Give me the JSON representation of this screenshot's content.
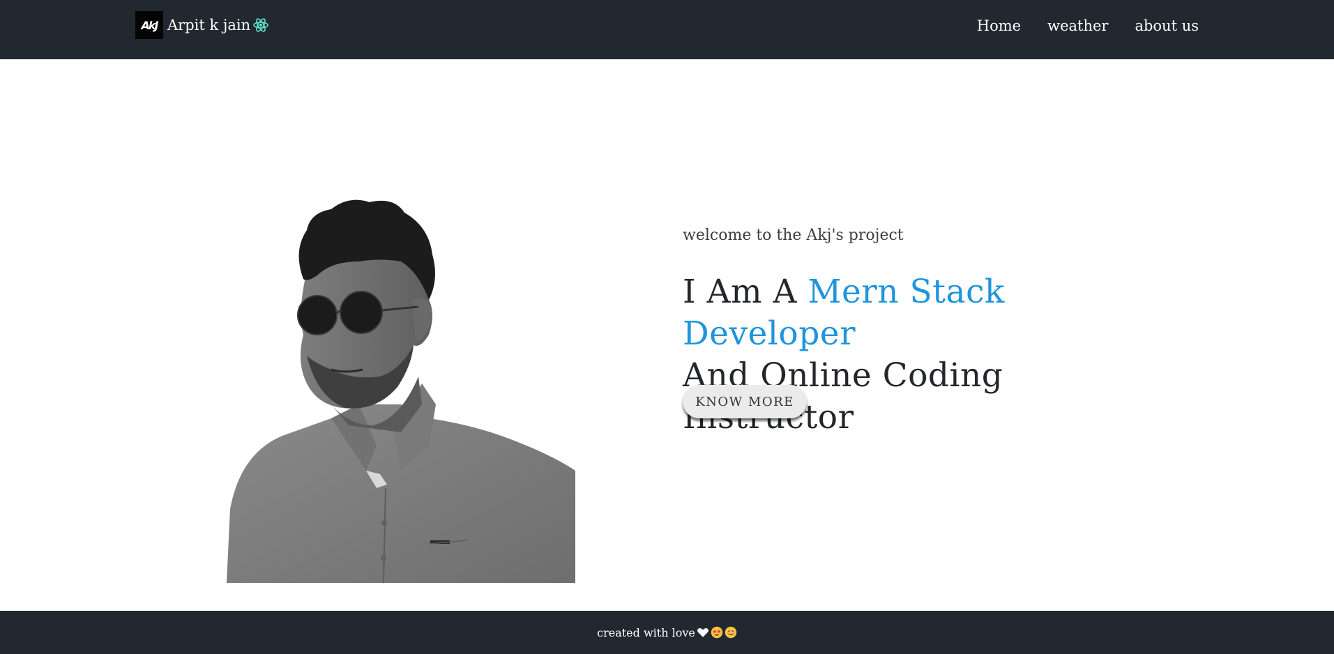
{
  "navbar": {
    "brand_logo_text": "AkJ",
    "brand_name": "Arpit k jain",
    "brand_icon": "react-atom-icon",
    "links": [
      {
        "label": "Home"
      },
      {
        "label": "weather"
      },
      {
        "label": "about us"
      }
    ]
  },
  "hero": {
    "photo_icon": "profile-photo",
    "welcome": "welcome to the Akj's project",
    "headline_prefix": "I Am A",
    "headline_accent": "Mern Stack Developer",
    "headline_suffix": "And Online Coding Instructor",
    "cta_label": "KNOW MORE"
  },
  "footer": {
    "text": "created with love",
    "emoji_icons": [
      "white-heart-icon",
      "star-struck-icon",
      "smiling-face-icon"
    ]
  },
  "colors": {
    "nav_bg": "#212830",
    "accent": "#1e95dc",
    "text_dark": "#23272b",
    "button_bg": "#ebebeb"
  }
}
